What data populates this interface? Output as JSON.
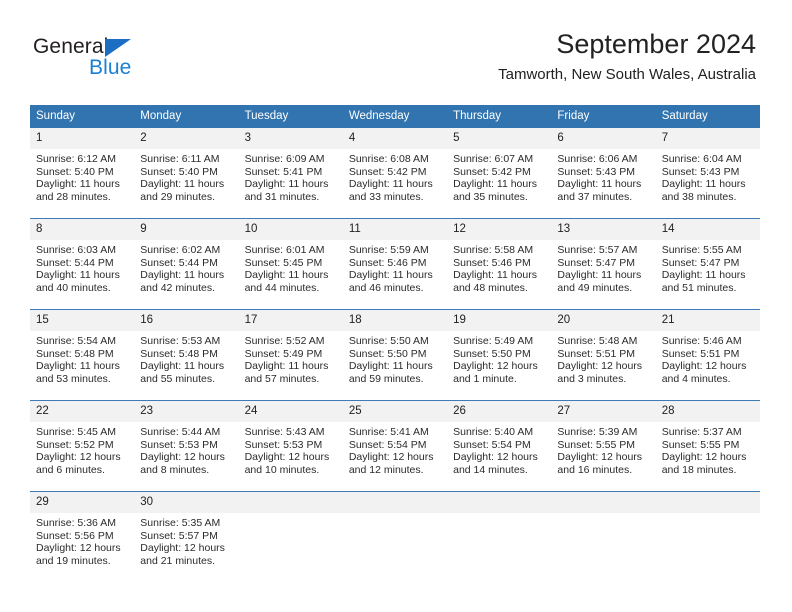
{
  "brand": {
    "word_one": "General",
    "word_two": "Blue",
    "flag_icon": "triangle-flag-icon"
  },
  "header": {
    "month_title": "September 2024",
    "location": "Tamworth, New South Wales, Australia"
  },
  "colors": {
    "header_blue": "#3174b0",
    "brand_blue": "#1b7fd4",
    "daynum_gray": "#f2f2f2",
    "row_divider": "#3c7cb4"
  },
  "labels": {
    "sunrise_prefix": "Sunrise:",
    "sunset_prefix": "Sunset:",
    "daylight_prefix": "Daylight:"
  },
  "weekdays": [
    "Sunday",
    "Monday",
    "Tuesday",
    "Wednesday",
    "Thursday",
    "Friday",
    "Saturday"
  ],
  "weeks": [
    [
      {
        "day": "1",
        "sunrise": "Sunrise: 6:12 AM",
        "sunset": "Sunset: 5:40 PM",
        "daylight_line1": "Daylight: 11 hours",
        "daylight_line2": "and 28 minutes."
      },
      {
        "day": "2",
        "sunrise": "Sunrise: 6:11 AM",
        "sunset": "Sunset: 5:40 PM",
        "daylight_line1": "Daylight: 11 hours",
        "daylight_line2": "and 29 minutes."
      },
      {
        "day": "3",
        "sunrise": "Sunrise: 6:09 AM",
        "sunset": "Sunset: 5:41 PM",
        "daylight_line1": "Daylight: 11 hours",
        "daylight_line2": "and 31 minutes."
      },
      {
        "day": "4",
        "sunrise": "Sunrise: 6:08 AM",
        "sunset": "Sunset: 5:42 PM",
        "daylight_line1": "Daylight: 11 hours",
        "daylight_line2": "and 33 minutes."
      },
      {
        "day": "5",
        "sunrise": "Sunrise: 6:07 AM",
        "sunset": "Sunset: 5:42 PM",
        "daylight_line1": "Daylight: 11 hours",
        "daylight_line2": "and 35 minutes."
      },
      {
        "day": "6",
        "sunrise": "Sunrise: 6:06 AM",
        "sunset": "Sunset: 5:43 PM",
        "daylight_line1": "Daylight: 11 hours",
        "daylight_line2": "and 37 minutes."
      },
      {
        "day": "7",
        "sunrise": "Sunrise: 6:04 AM",
        "sunset": "Sunset: 5:43 PM",
        "daylight_line1": "Daylight: 11 hours",
        "daylight_line2": "and 38 minutes."
      }
    ],
    [
      {
        "day": "8",
        "sunrise": "Sunrise: 6:03 AM",
        "sunset": "Sunset: 5:44 PM",
        "daylight_line1": "Daylight: 11 hours",
        "daylight_line2": "and 40 minutes."
      },
      {
        "day": "9",
        "sunrise": "Sunrise: 6:02 AM",
        "sunset": "Sunset: 5:44 PM",
        "daylight_line1": "Daylight: 11 hours",
        "daylight_line2": "and 42 minutes."
      },
      {
        "day": "10",
        "sunrise": "Sunrise: 6:01 AM",
        "sunset": "Sunset: 5:45 PM",
        "daylight_line1": "Daylight: 11 hours",
        "daylight_line2": "and 44 minutes."
      },
      {
        "day": "11",
        "sunrise": "Sunrise: 5:59 AM",
        "sunset": "Sunset: 5:46 PM",
        "daylight_line1": "Daylight: 11 hours",
        "daylight_line2": "and 46 minutes."
      },
      {
        "day": "12",
        "sunrise": "Sunrise: 5:58 AM",
        "sunset": "Sunset: 5:46 PM",
        "daylight_line1": "Daylight: 11 hours",
        "daylight_line2": "and 48 minutes."
      },
      {
        "day": "13",
        "sunrise": "Sunrise: 5:57 AM",
        "sunset": "Sunset: 5:47 PM",
        "daylight_line1": "Daylight: 11 hours",
        "daylight_line2": "and 49 minutes."
      },
      {
        "day": "14",
        "sunrise": "Sunrise: 5:55 AM",
        "sunset": "Sunset: 5:47 PM",
        "daylight_line1": "Daylight: 11 hours",
        "daylight_line2": "and 51 minutes."
      }
    ],
    [
      {
        "day": "15",
        "sunrise": "Sunrise: 5:54 AM",
        "sunset": "Sunset: 5:48 PM",
        "daylight_line1": "Daylight: 11 hours",
        "daylight_line2": "and 53 minutes."
      },
      {
        "day": "16",
        "sunrise": "Sunrise: 5:53 AM",
        "sunset": "Sunset: 5:48 PM",
        "daylight_line1": "Daylight: 11 hours",
        "daylight_line2": "and 55 minutes."
      },
      {
        "day": "17",
        "sunrise": "Sunrise: 5:52 AM",
        "sunset": "Sunset: 5:49 PM",
        "daylight_line1": "Daylight: 11 hours",
        "daylight_line2": "and 57 minutes."
      },
      {
        "day": "18",
        "sunrise": "Sunrise: 5:50 AM",
        "sunset": "Sunset: 5:50 PM",
        "daylight_line1": "Daylight: 11 hours",
        "daylight_line2": "and 59 minutes."
      },
      {
        "day": "19",
        "sunrise": "Sunrise: 5:49 AM",
        "sunset": "Sunset: 5:50 PM",
        "daylight_line1": "Daylight: 12 hours",
        "daylight_line2": "and 1 minute."
      },
      {
        "day": "20",
        "sunrise": "Sunrise: 5:48 AM",
        "sunset": "Sunset: 5:51 PM",
        "daylight_line1": "Daylight: 12 hours",
        "daylight_line2": "and 3 minutes."
      },
      {
        "day": "21",
        "sunrise": "Sunrise: 5:46 AM",
        "sunset": "Sunset: 5:51 PM",
        "daylight_line1": "Daylight: 12 hours",
        "daylight_line2": "and 4 minutes."
      }
    ],
    [
      {
        "day": "22",
        "sunrise": "Sunrise: 5:45 AM",
        "sunset": "Sunset: 5:52 PM",
        "daylight_line1": "Daylight: 12 hours",
        "daylight_line2": "and 6 minutes."
      },
      {
        "day": "23",
        "sunrise": "Sunrise: 5:44 AM",
        "sunset": "Sunset: 5:53 PM",
        "daylight_line1": "Daylight: 12 hours",
        "daylight_line2": "and 8 minutes."
      },
      {
        "day": "24",
        "sunrise": "Sunrise: 5:43 AM",
        "sunset": "Sunset: 5:53 PM",
        "daylight_line1": "Daylight: 12 hours",
        "daylight_line2": "and 10 minutes."
      },
      {
        "day": "25",
        "sunrise": "Sunrise: 5:41 AM",
        "sunset": "Sunset: 5:54 PM",
        "daylight_line1": "Daylight: 12 hours",
        "daylight_line2": "and 12 minutes."
      },
      {
        "day": "26",
        "sunrise": "Sunrise: 5:40 AM",
        "sunset": "Sunset: 5:54 PM",
        "daylight_line1": "Daylight: 12 hours",
        "daylight_line2": "and 14 minutes."
      },
      {
        "day": "27",
        "sunrise": "Sunrise: 5:39 AM",
        "sunset": "Sunset: 5:55 PM",
        "daylight_line1": "Daylight: 12 hours",
        "daylight_line2": "and 16 minutes."
      },
      {
        "day": "28",
        "sunrise": "Sunrise: 5:37 AM",
        "sunset": "Sunset: 5:55 PM",
        "daylight_line1": "Daylight: 12 hours",
        "daylight_line2": "and 18 minutes."
      }
    ],
    [
      {
        "day": "29",
        "sunrise": "Sunrise: 5:36 AM",
        "sunset": "Sunset: 5:56 PM",
        "daylight_line1": "Daylight: 12 hours",
        "daylight_line2": "and 19 minutes."
      },
      {
        "day": "30",
        "sunrise": "Sunrise: 5:35 AM",
        "sunset": "Sunset: 5:57 PM",
        "daylight_line1": "Daylight: 12 hours",
        "daylight_line2": "and 21 minutes."
      },
      {
        "day": "",
        "sunrise": "",
        "sunset": "",
        "daylight_line1": "",
        "daylight_line2": ""
      },
      {
        "day": "",
        "sunrise": "",
        "sunset": "",
        "daylight_line1": "",
        "daylight_line2": ""
      },
      {
        "day": "",
        "sunrise": "",
        "sunset": "",
        "daylight_line1": "",
        "daylight_line2": ""
      },
      {
        "day": "",
        "sunrise": "",
        "sunset": "",
        "daylight_line1": "",
        "daylight_line2": ""
      },
      {
        "day": "",
        "sunrise": "",
        "sunset": "",
        "daylight_line1": "",
        "daylight_line2": ""
      }
    ]
  ]
}
